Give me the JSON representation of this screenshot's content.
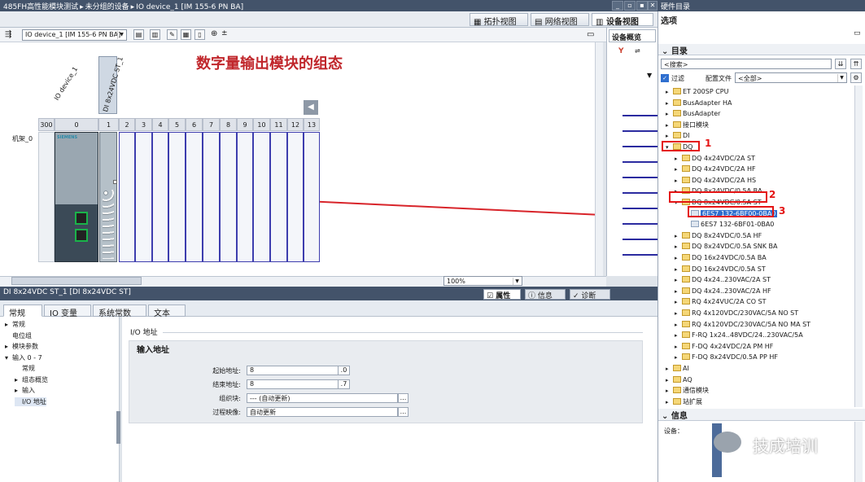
{
  "window": {
    "title_parts": [
      "485FH高性能模块测试",
      "未分组的设备",
      "IO device_1 [IM 155-6 PN BA]"
    ],
    "separator": "▸",
    "controls": [
      "_",
      "▫",
      "▪",
      "✕"
    ]
  },
  "hardware_catalog_title": "硬件目录",
  "view_tabs": {
    "topology": "拓扑视图",
    "network": "网络视图",
    "device": "设备视图"
  },
  "toolbar": {
    "device_select": "IO device_1 [IM 155-6 PN BA]",
    "zoom": "100%"
  },
  "canvas": {
    "annotation": "数字量输出模块的组态",
    "device_label": "IO device_1",
    "module_label": "DI 8x24VDC ST_1",
    "rack_label": "机架_0",
    "slot_numbers": [
      "300",
      "0",
      "1",
      "2",
      "3",
      "4",
      "5",
      "6",
      "7",
      "8",
      "9",
      "10",
      "11",
      "12",
      "13"
    ],
    "siemens": "SIEMENS"
  },
  "overview": {
    "tab": "设备概览"
  },
  "properties": {
    "title": "DI 8x24VDC ST_1 [DI 8x24VDC ST]",
    "right_tabs": {
      "props": "属性",
      "info": "信息",
      "diag": "诊断"
    },
    "tabs": [
      "常规",
      "IO 变量",
      "系统常数",
      "文本"
    ],
    "nav": [
      {
        "label": "常规",
        "level": 0,
        "arrow": "▸"
      },
      {
        "label": "电位组",
        "level": 0,
        "arrow": ""
      },
      {
        "label": "模块参数",
        "level": 0,
        "arrow": "▸"
      },
      {
        "label": "输入 0 - 7",
        "level": 0,
        "arrow": "▾"
      },
      {
        "label": "常规",
        "level": 1,
        "arrow": ""
      },
      {
        "label": "组态概览",
        "level": 1,
        "arrow": "▸"
      },
      {
        "label": "输入",
        "level": 1,
        "arrow": "▸"
      },
      {
        "label": "I/O 地址",
        "level": 1,
        "arrow": "",
        "selected": true
      }
    ],
    "panel_title": "I/O 地址",
    "section_title": "输入地址",
    "fields": [
      {
        "label": "起始地址:",
        "value": "8",
        "suffix": ".0"
      },
      {
        "label": "结束地址:",
        "value": "8",
        "suffix": ".7"
      },
      {
        "label": "组织块:",
        "value": "--- (自动更新)",
        "suffix": "..."
      },
      {
        "label": "过程映像:",
        "value": "自动更新",
        "suffix": "..."
      }
    ]
  },
  "catalog": {
    "options": "选项",
    "directory": "目录",
    "search_placeholder": "<搜索>",
    "filter_label": "过滤",
    "profile_label": "配置文件",
    "profile_value": "<全部>",
    "items": [
      {
        "label": "ET 200SP CPU",
        "level": 0,
        "arrow": "▸",
        "folder": true
      },
      {
        "label": "BusAdapter HA",
        "level": 0,
        "arrow": "▸",
        "folder": true
      },
      {
        "label": "BusAdapter",
        "level": 0,
        "arrow": "▸",
        "folder": true
      },
      {
        "label": "接口模块",
        "level": 0,
        "arrow": "▸",
        "folder": true
      },
      {
        "label": "DI",
        "level": 0,
        "arrow": "▸",
        "folder": true
      },
      {
        "label": "DQ",
        "level": 0,
        "arrow": "▾",
        "folder": true
      },
      {
        "label": "DQ 4x24VDC/2A ST",
        "level": 1,
        "arrow": "▸",
        "folder": true
      },
      {
        "label": "DQ 4x24VDC/2A HF",
        "level": 1,
        "arrow": "▸",
        "folder": true
      },
      {
        "label": "DQ 4x24VDC/2A HS",
        "level": 1,
        "arrow": "▸",
        "folder": true
      },
      {
        "label": "DQ 8x24VDC/0.5A BA",
        "level": 1,
        "arrow": "▸",
        "folder": true
      },
      {
        "label": "DQ 8x24VDC/0.5A ST",
        "level": 1,
        "arrow": "▾",
        "folder": true
      },
      {
        "label": "6ES7 132-6BF00-0BA0",
        "level": 2,
        "arrow": "",
        "folder": false,
        "selected": true
      },
      {
        "label": "6ES7 132-6BF01-0BA0",
        "level": 2,
        "arrow": "",
        "folder": false
      },
      {
        "label": "DQ 8x24VDC/0.5A HF",
        "level": 1,
        "arrow": "▸",
        "folder": true
      },
      {
        "label": "DQ 8x24VDC/0.5A SNK BA",
        "level": 1,
        "arrow": "▸",
        "folder": true
      },
      {
        "label": "DQ 16x24VDC/0.5A BA",
        "level": 1,
        "arrow": "▸",
        "folder": true
      },
      {
        "label": "DQ 16x24VDC/0.5A ST",
        "level": 1,
        "arrow": "▸",
        "folder": true
      },
      {
        "label": "DQ 4x24..230VAC/2A ST",
        "level": 1,
        "arrow": "▸",
        "folder": true
      },
      {
        "label": "DQ 4x24..230VAC/2A HF",
        "level": 1,
        "arrow": "▸",
        "folder": true
      },
      {
        "label": "RQ 4x24VUC/2A CO ST",
        "level": 1,
        "arrow": "▸",
        "folder": true
      },
      {
        "label": "RQ 4x120VDC/230VAC/5A NO ST",
        "level": 1,
        "arrow": "▸",
        "folder": true
      },
      {
        "label": "RQ 4x120VDC/230VAC/5A NO MA ST",
        "level": 1,
        "arrow": "▸",
        "folder": true
      },
      {
        "label": "F-RQ 1x24..48VDC/24..230VAC/5A",
        "level": 1,
        "arrow": "▸",
        "folder": true
      },
      {
        "label": "F-DQ 4x24VDC/2A PM HF",
        "level": 1,
        "arrow": "▸",
        "folder": true
      },
      {
        "label": "F-DQ 8x24VDC/0.5A PP HF",
        "level": 1,
        "arrow": "▸",
        "folder": true
      },
      {
        "label": "AI",
        "level": 0,
        "arrow": "▸",
        "folder": true
      },
      {
        "label": "AQ",
        "level": 0,
        "arrow": "▸",
        "folder": true
      },
      {
        "label": "通信模块",
        "level": 0,
        "arrow": "▸",
        "folder": true
      },
      {
        "label": "站扩展",
        "level": 0,
        "arrow": "▸",
        "folder": true
      }
    ],
    "markers": [
      "1",
      "2",
      "3"
    ],
    "info_title": "信息",
    "device_label": "设备："
  },
  "watermark": "技成培训",
  "colors": {
    "titlebar": "#43536a",
    "slot_border": "#3d3dae",
    "annotation": "#c0262b",
    "highlight": "#e41414",
    "selection": "#2f6fcf"
  }
}
